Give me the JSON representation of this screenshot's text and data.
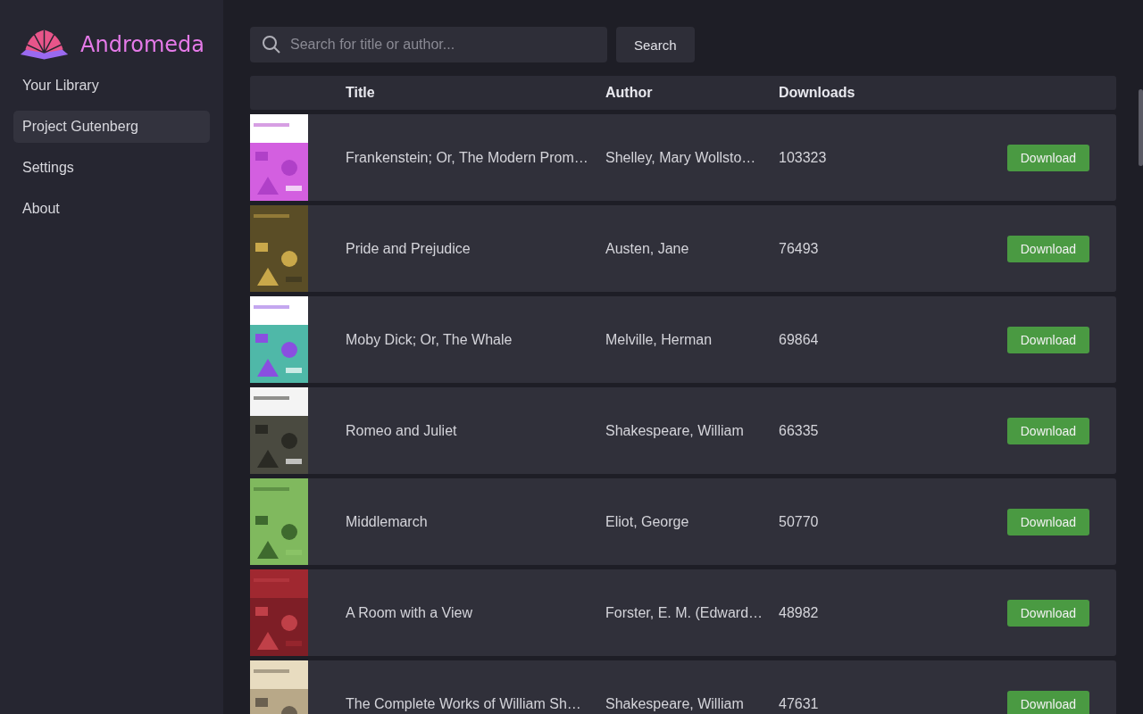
{
  "app": {
    "name": "Andromeda"
  },
  "sidebar": {
    "items": [
      {
        "label": "Your Library",
        "selected": false
      },
      {
        "label": "Project Gutenberg",
        "selected": true
      },
      {
        "label": "Settings",
        "selected": false
      },
      {
        "label": "About",
        "selected": false
      }
    ]
  },
  "search": {
    "placeholder": "Search for title or author...",
    "button": "Search"
  },
  "table": {
    "columns": [
      "Title",
      "Author",
      "Downloads"
    ],
    "rows": [
      {
        "title": "Frankenstein; Or, The Modern Prom…",
        "author": "Shelley, Mary Wollsto…",
        "downloads": "103323",
        "action": "Download"
      },
      {
        "title": "Pride and Prejudice",
        "author": "Austen, Jane",
        "downloads": "76493",
        "action": "Download"
      },
      {
        "title": "Moby Dick; Or, The Whale",
        "author": "Melville, Herman",
        "downloads": "69864",
        "action": "Download"
      },
      {
        "title": "Romeo and Juliet",
        "author": "Shakespeare, William",
        "downloads": "66335",
        "action": "Download"
      },
      {
        "title": "Middlemarch",
        "author": "Eliot, George",
        "downloads": "50770",
        "action": "Download"
      },
      {
        "title": "A Room with a View",
        "author": "Forster, E. M. (Edward…",
        "downloads": "48982",
        "action": "Download"
      },
      {
        "title": "The Complete Works of William Sh…",
        "author": "Shakespeare, William",
        "downloads": "47631",
        "action": "Download"
      }
    ]
  }
}
